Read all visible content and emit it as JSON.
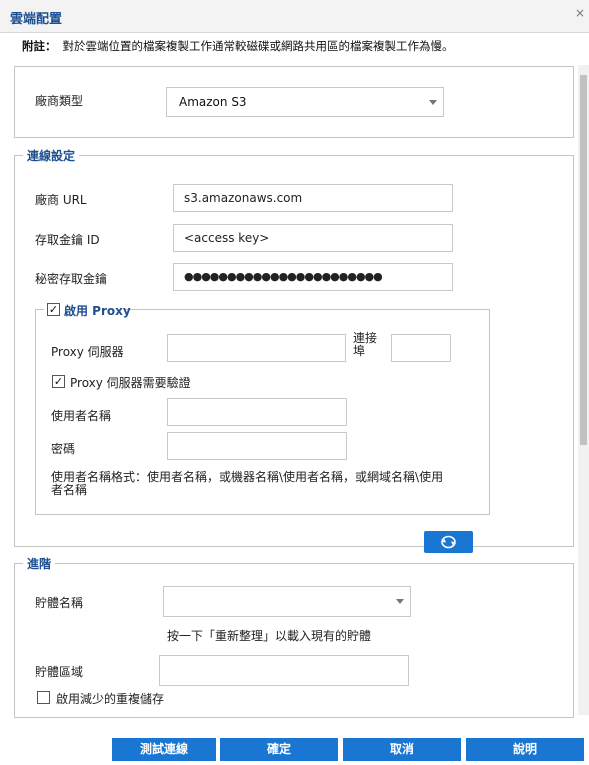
{
  "dialog": {
    "title": "雲端配置",
    "close_glyph": "×"
  },
  "note": {
    "label": "附註：",
    "text": "對於雲端位置的檔案複製工作通常較磁碟或網路共用區的檔案複製工作為慢。"
  },
  "vendor": {
    "type_label": "廠商類型",
    "type_value": "Amazon S3"
  },
  "connection": {
    "legend": "連線設定",
    "url_label": "廠商 URL",
    "url_value": "s3.amazonaws.com",
    "access_key_label": "存取金鑰 ID",
    "access_key_value": "<access key>",
    "secret_key_label": "秘密存取金鑰",
    "secret_key_value": "●●●●●●●●●●●●●●●●●●●●●●●"
  },
  "proxy": {
    "enable_label": "啟用 Proxy",
    "enable_checked": true,
    "server_label": "Proxy 伺服器",
    "server_value": "",
    "port_label": "連接埠",
    "port_value": "",
    "auth_label": "Proxy 伺服器需要驗證",
    "auth_checked": true,
    "username_label": "使用者名稱",
    "username_value": "",
    "password_label": "密碼",
    "password_value": "",
    "username_hint": "使用者名稱格式：使用者名稱，或機器名稱\\使用者名稱，或網域名稱\\使用者名稱"
  },
  "advanced": {
    "legend": "進階",
    "bucket_label": "貯體名稱",
    "bucket_value": "",
    "refresh_hint": "按一下「重新整理」以載入現有的貯體",
    "region_label": "貯體區域",
    "region_value": "",
    "rrs_label": "啟用減少的重複儲存",
    "rrs_checked": false
  },
  "footer": {
    "test_label": "測試連線",
    "ok_label": "確定",
    "cancel_label": "取消",
    "help_label": "說明"
  },
  "colors": {
    "accent": "#1976d2",
    "title": "#1d4f91"
  }
}
